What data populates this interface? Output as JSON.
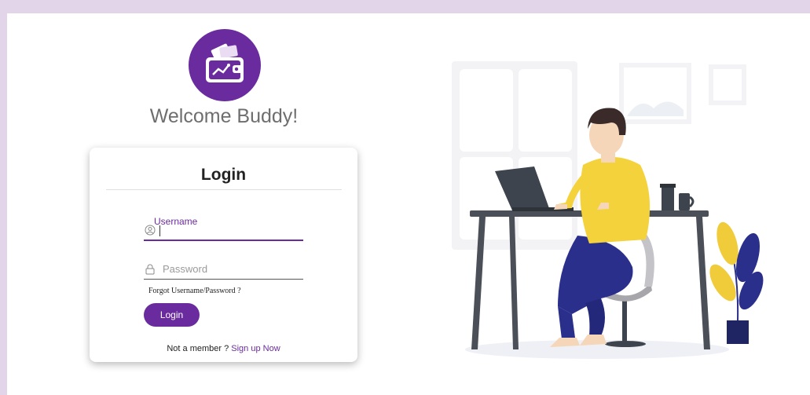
{
  "header": {
    "welcome": "Welcome Buddy!"
  },
  "logo": {
    "icon": "wallet-icon"
  },
  "login_card": {
    "title": "Login",
    "username_label": "Username",
    "password_placeholder": "Password",
    "forgot_link": "Forgot Username/Password ?",
    "login_button": "Login",
    "not_member_text": "Not a member ?",
    "signup_link": "Sign up Now"
  },
  "colors": {
    "accent": "#6a2b9e",
    "frame": "#e2d5ea"
  },
  "illustration": {
    "description_icon": "person-at-laptop-illustration"
  }
}
